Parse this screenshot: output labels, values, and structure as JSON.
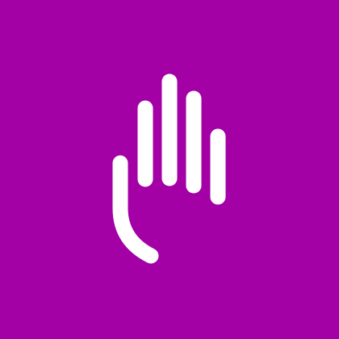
{
  "colors": {
    "background": "#A300A6",
    "icon": "#FFFFFF"
  },
  "icon": {
    "name": "raised-hand-icon"
  }
}
